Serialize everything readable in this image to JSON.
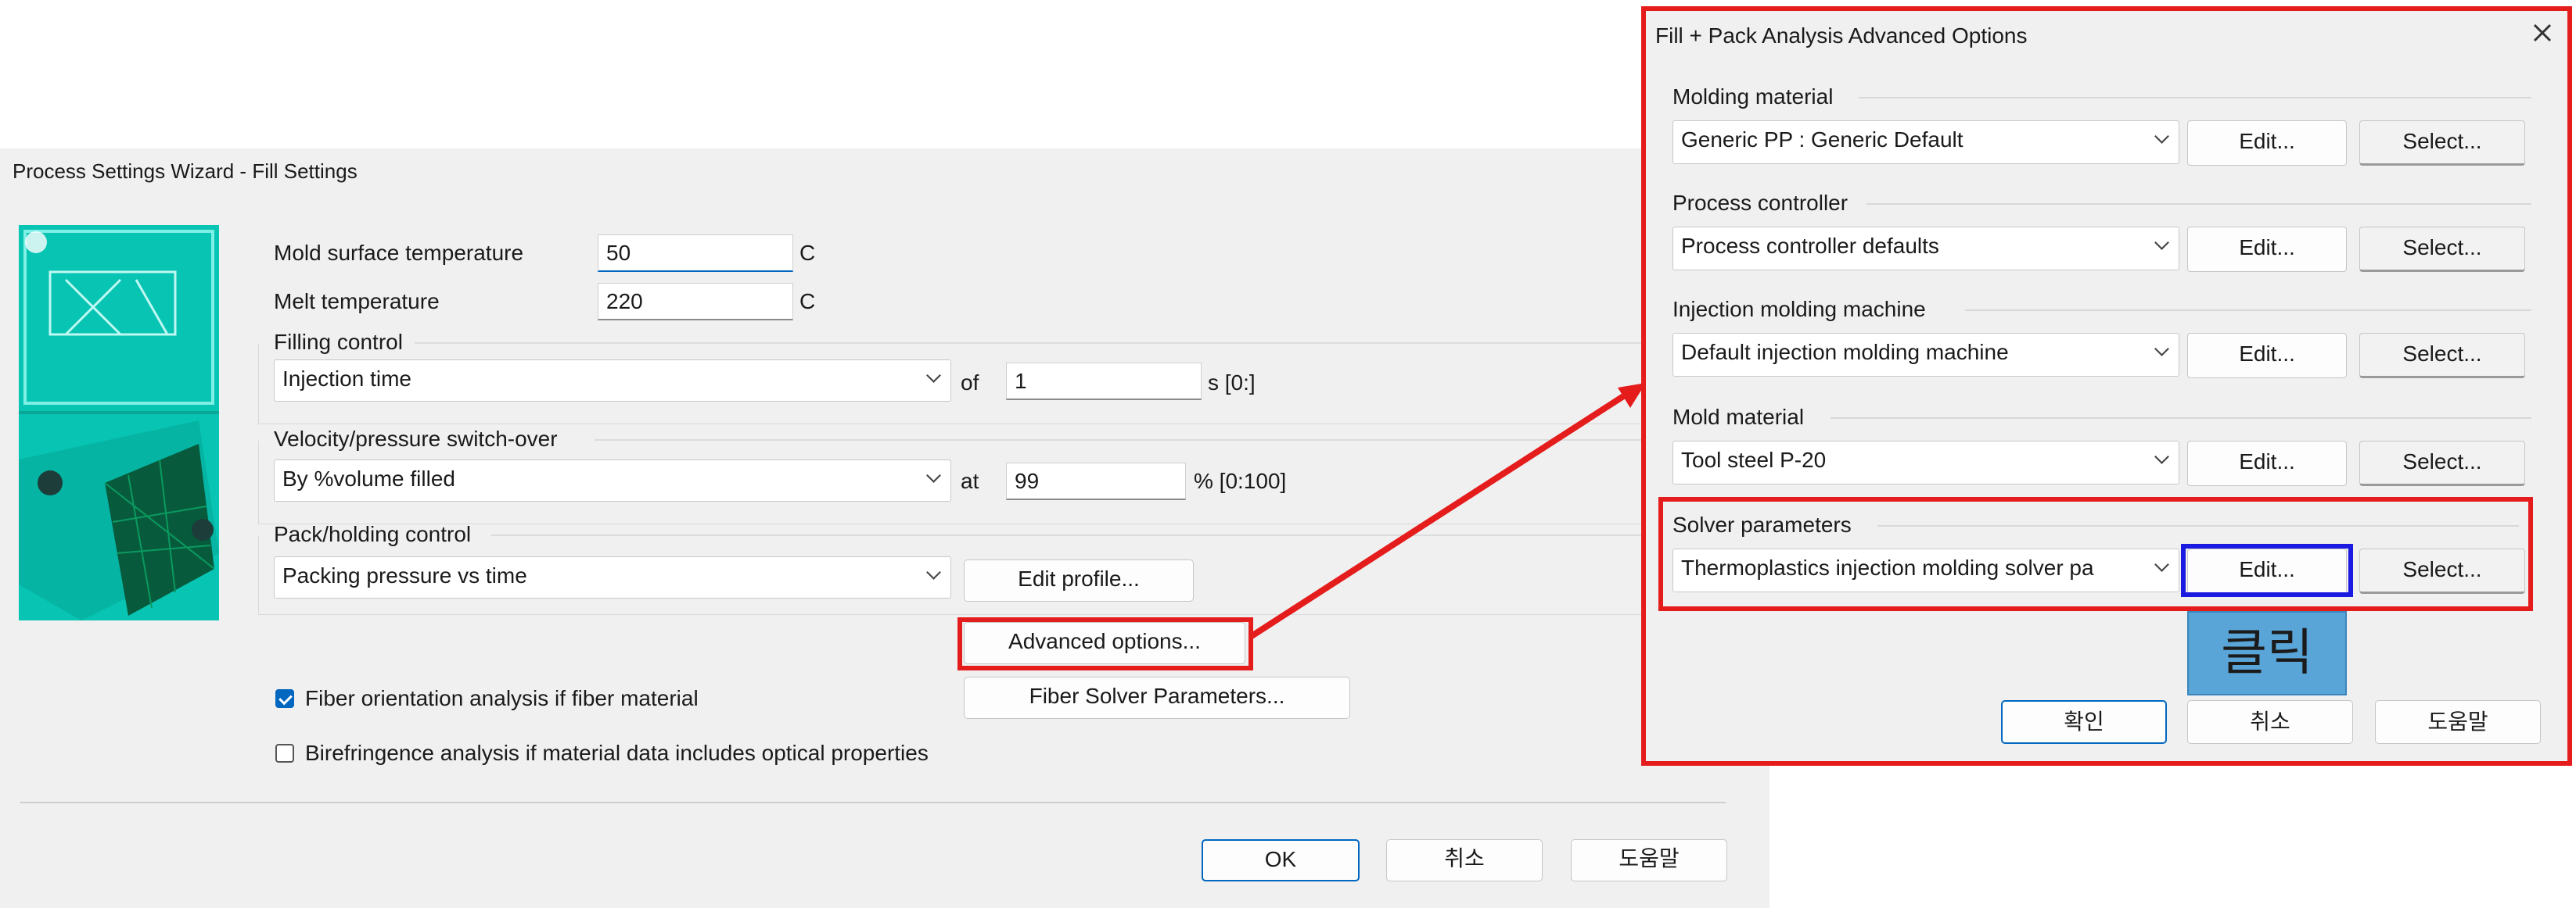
{
  "wizard": {
    "title": "Process Settings Wizard - Fill Settings",
    "mold_surface_temp": {
      "label": "Mold surface temperature",
      "value": "50",
      "unit": "C"
    },
    "melt_temp": {
      "label": "Melt temperature",
      "value": "220",
      "unit": "C"
    },
    "filling_control": {
      "label": "Filling control",
      "selected": "Injection time",
      "of_label": "of",
      "value": "1",
      "range": "s [0:]"
    },
    "vp_switch": {
      "label": "Velocity/pressure switch-over",
      "selected": "By %volume filled",
      "at_label": "at",
      "value": "99",
      "range": "% [0:100]"
    },
    "pack": {
      "label": "Pack/holding control",
      "selected": "Packing pressure vs time",
      "edit_profile": "Edit profile..."
    },
    "advanced_options": "Advanced options...",
    "fiber_solver": "Fiber Solver Parameters...",
    "fiber_orientation": {
      "label": "Fiber orientation analysis if fiber material",
      "checked": true
    },
    "birefringence": {
      "label": "Birefringence analysis if material data includes optical properties",
      "checked": false
    },
    "ok": "OK",
    "cancel": "취소",
    "help": "도움말"
  },
  "advanced": {
    "title": "Fill + Pack Analysis Advanced Options",
    "sections": [
      {
        "label": "Molding material",
        "selected": "Generic PP : Generic Default",
        "edit": "Edit...",
        "select": "Select..."
      },
      {
        "label": "Process controller",
        "selected": "Process controller defaults",
        "edit": "Edit...",
        "select": "Select..."
      },
      {
        "label": "Injection molding machine",
        "selected": "Default injection molding machine",
        "edit": "Edit...",
        "select": "Select..."
      },
      {
        "label": "Mold material",
        "selected": "Tool steel P-20",
        "edit": "Edit...",
        "select": "Select..."
      },
      {
        "label": "Solver parameters",
        "selected": "Thermoplastics injection molding solver pa",
        "edit": "Edit...",
        "select": "Select..."
      }
    ],
    "confirm": "확인",
    "cancel": "취소",
    "help": "도움말"
  },
  "annotation": {
    "click_label": "클릭"
  },
  "colors": {
    "highlight_red": "#e51c1c",
    "highlight_blue": "#1a1ae0",
    "accent": "#0067c0",
    "callout": "#5aa5d8"
  }
}
